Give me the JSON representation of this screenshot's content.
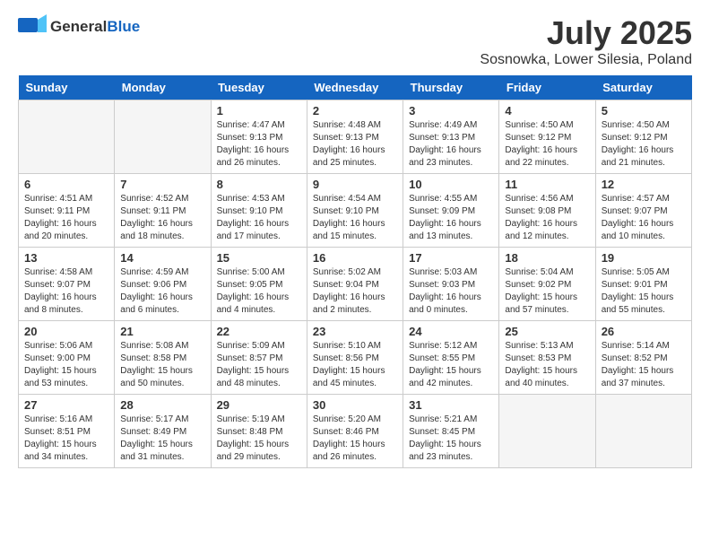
{
  "header": {
    "logo_general": "General",
    "logo_blue": "Blue",
    "month_title": "July 2025",
    "location": "Sosnowka, Lower Silesia, Poland"
  },
  "weekdays": [
    "Sunday",
    "Monday",
    "Tuesday",
    "Wednesday",
    "Thursday",
    "Friday",
    "Saturday"
  ],
  "weeks": [
    [
      {
        "day": "",
        "detail": ""
      },
      {
        "day": "",
        "detail": ""
      },
      {
        "day": "1",
        "detail": "Sunrise: 4:47 AM\nSunset: 9:13 PM\nDaylight: 16 hours\nand 26 minutes."
      },
      {
        "day": "2",
        "detail": "Sunrise: 4:48 AM\nSunset: 9:13 PM\nDaylight: 16 hours\nand 25 minutes."
      },
      {
        "day": "3",
        "detail": "Sunrise: 4:49 AM\nSunset: 9:13 PM\nDaylight: 16 hours\nand 23 minutes."
      },
      {
        "day": "4",
        "detail": "Sunrise: 4:50 AM\nSunset: 9:12 PM\nDaylight: 16 hours\nand 22 minutes."
      },
      {
        "day": "5",
        "detail": "Sunrise: 4:50 AM\nSunset: 9:12 PM\nDaylight: 16 hours\nand 21 minutes."
      }
    ],
    [
      {
        "day": "6",
        "detail": "Sunrise: 4:51 AM\nSunset: 9:11 PM\nDaylight: 16 hours\nand 20 minutes."
      },
      {
        "day": "7",
        "detail": "Sunrise: 4:52 AM\nSunset: 9:11 PM\nDaylight: 16 hours\nand 18 minutes."
      },
      {
        "day": "8",
        "detail": "Sunrise: 4:53 AM\nSunset: 9:10 PM\nDaylight: 16 hours\nand 17 minutes."
      },
      {
        "day": "9",
        "detail": "Sunrise: 4:54 AM\nSunset: 9:10 PM\nDaylight: 16 hours\nand 15 minutes."
      },
      {
        "day": "10",
        "detail": "Sunrise: 4:55 AM\nSunset: 9:09 PM\nDaylight: 16 hours\nand 13 minutes."
      },
      {
        "day": "11",
        "detail": "Sunrise: 4:56 AM\nSunset: 9:08 PM\nDaylight: 16 hours\nand 12 minutes."
      },
      {
        "day": "12",
        "detail": "Sunrise: 4:57 AM\nSunset: 9:07 PM\nDaylight: 16 hours\nand 10 minutes."
      }
    ],
    [
      {
        "day": "13",
        "detail": "Sunrise: 4:58 AM\nSunset: 9:07 PM\nDaylight: 16 hours\nand 8 minutes."
      },
      {
        "day": "14",
        "detail": "Sunrise: 4:59 AM\nSunset: 9:06 PM\nDaylight: 16 hours\nand 6 minutes."
      },
      {
        "day": "15",
        "detail": "Sunrise: 5:00 AM\nSunset: 9:05 PM\nDaylight: 16 hours\nand 4 minutes."
      },
      {
        "day": "16",
        "detail": "Sunrise: 5:02 AM\nSunset: 9:04 PM\nDaylight: 16 hours\nand 2 minutes."
      },
      {
        "day": "17",
        "detail": "Sunrise: 5:03 AM\nSunset: 9:03 PM\nDaylight: 16 hours\nand 0 minutes."
      },
      {
        "day": "18",
        "detail": "Sunrise: 5:04 AM\nSunset: 9:02 PM\nDaylight: 15 hours\nand 57 minutes."
      },
      {
        "day": "19",
        "detail": "Sunrise: 5:05 AM\nSunset: 9:01 PM\nDaylight: 15 hours\nand 55 minutes."
      }
    ],
    [
      {
        "day": "20",
        "detail": "Sunrise: 5:06 AM\nSunset: 9:00 PM\nDaylight: 15 hours\nand 53 minutes."
      },
      {
        "day": "21",
        "detail": "Sunrise: 5:08 AM\nSunset: 8:58 PM\nDaylight: 15 hours\nand 50 minutes."
      },
      {
        "day": "22",
        "detail": "Sunrise: 5:09 AM\nSunset: 8:57 PM\nDaylight: 15 hours\nand 48 minutes."
      },
      {
        "day": "23",
        "detail": "Sunrise: 5:10 AM\nSunset: 8:56 PM\nDaylight: 15 hours\nand 45 minutes."
      },
      {
        "day": "24",
        "detail": "Sunrise: 5:12 AM\nSunset: 8:55 PM\nDaylight: 15 hours\nand 42 minutes."
      },
      {
        "day": "25",
        "detail": "Sunrise: 5:13 AM\nSunset: 8:53 PM\nDaylight: 15 hours\nand 40 minutes."
      },
      {
        "day": "26",
        "detail": "Sunrise: 5:14 AM\nSunset: 8:52 PM\nDaylight: 15 hours\nand 37 minutes."
      }
    ],
    [
      {
        "day": "27",
        "detail": "Sunrise: 5:16 AM\nSunset: 8:51 PM\nDaylight: 15 hours\nand 34 minutes."
      },
      {
        "day": "28",
        "detail": "Sunrise: 5:17 AM\nSunset: 8:49 PM\nDaylight: 15 hours\nand 31 minutes."
      },
      {
        "day": "29",
        "detail": "Sunrise: 5:19 AM\nSunset: 8:48 PM\nDaylight: 15 hours\nand 29 minutes."
      },
      {
        "day": "30",
        "detail": "Sunrise: 5:20 AM\nSunset: 8:46 PM\nDaylight: 15 hours\nand 26 minutes."
      },
      {
        "day": "31",
        "detail": "Sunrise: 5:21 AM\nSunset: 8:45 PM\nDaylight: 15 hours\nand 23 minutes."
      },
      {
        "day": "",
        "detail": ""
      },
      {
        "day": "",
        "detail": ""
      }
    ]
  ]
}
